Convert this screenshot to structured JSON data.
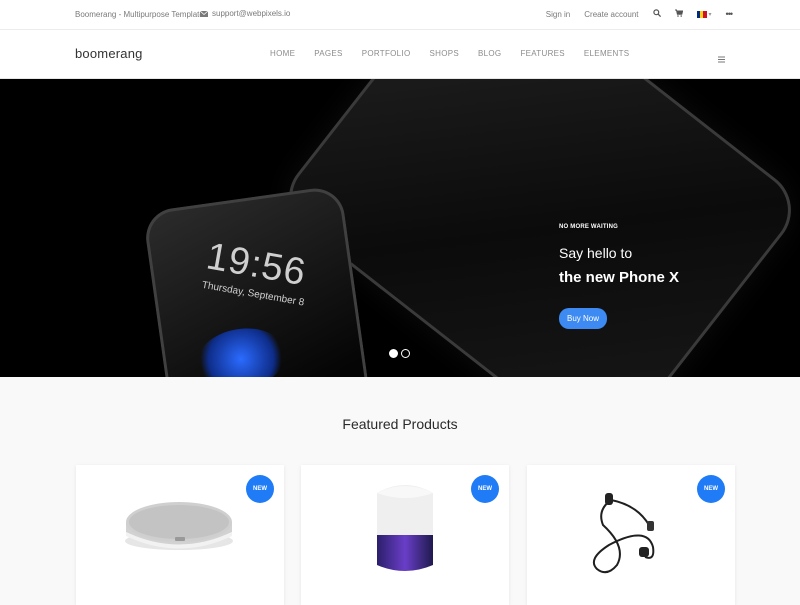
{
  "topbar": {
    "site_name": "Boomerang - Multipurpose Template",
    "support_email": "support@webpixels.io",
    "sign_in": "Sign in",
    "create_account": "Create account"
  },
  "navbar": {
    "logo": "boomerang",
    "items": [
      "HOME",
      "PAGES",
      "PORTFOLIO",
      "SHOPS",
      "BLOG",
      "FEATURES",
      "ELEMENTS"
    ]
  },
  "hero": {
    "phone_time": "19:56",
    "phone_date": "Thursday, September 8",
    "eyebrow": "NO MORE WAITING",
    "line1": "Say hello to",
    "line2": "the new Phone X",
    "cta": "Buy Now",
    "slides": 2,
    "active_slide": 1
  },
  "featured": {
    "title": "Featured Products",
    "products": [
      {
        "badge": "NEW",
        "image": "smart-speaker-mini"
      },
      {
        "badge": "NEW",
        "image": "smart-speaker"
      },
      {
        "badge": "NEW",
        "image": "wireless-earbuds"
      }
    ]
  },
  "colors": {
    "accent": "#1f7cf6",
    "button": "#3d8bf2"
  }
}
